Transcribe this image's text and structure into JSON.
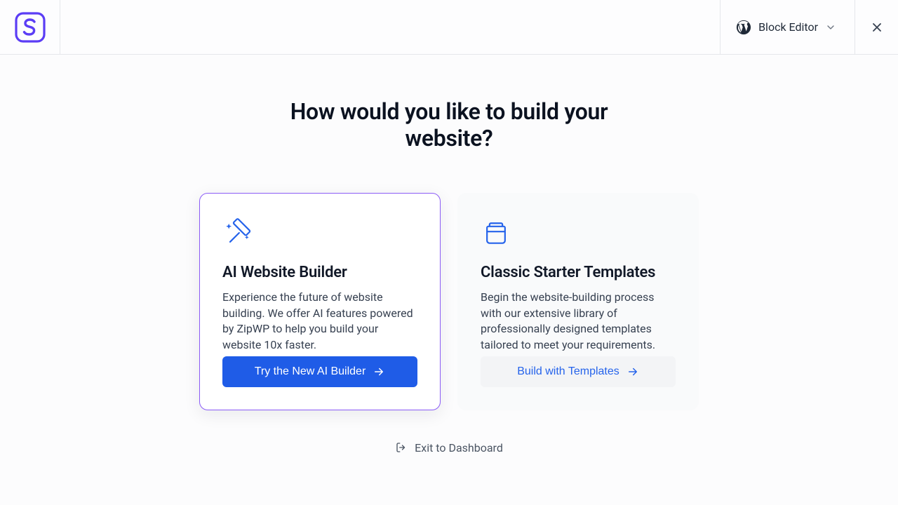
{
  "header": {
    "editor_label": "Block Editor"
  },
  "heading": "How would you like to build your website?",
  "cards": {
    "ai": {
      "title": "AI Website Builder",
      "desc": "Experience the future of website building. We offer AI features powered by ZipWP to help you build your website 10x faster.",
      "button": "Try the New AI Builder"
    },
    "classic": {
      "title": "Classic Starter Templates",
      "desc": "Begin the website-building process with our extensive library of professionally designed templates tailored to meet your requirements.",
      "button": "Build with Templates"
    }
  },
  "exit_label": "Exit to Dashboard"
}
